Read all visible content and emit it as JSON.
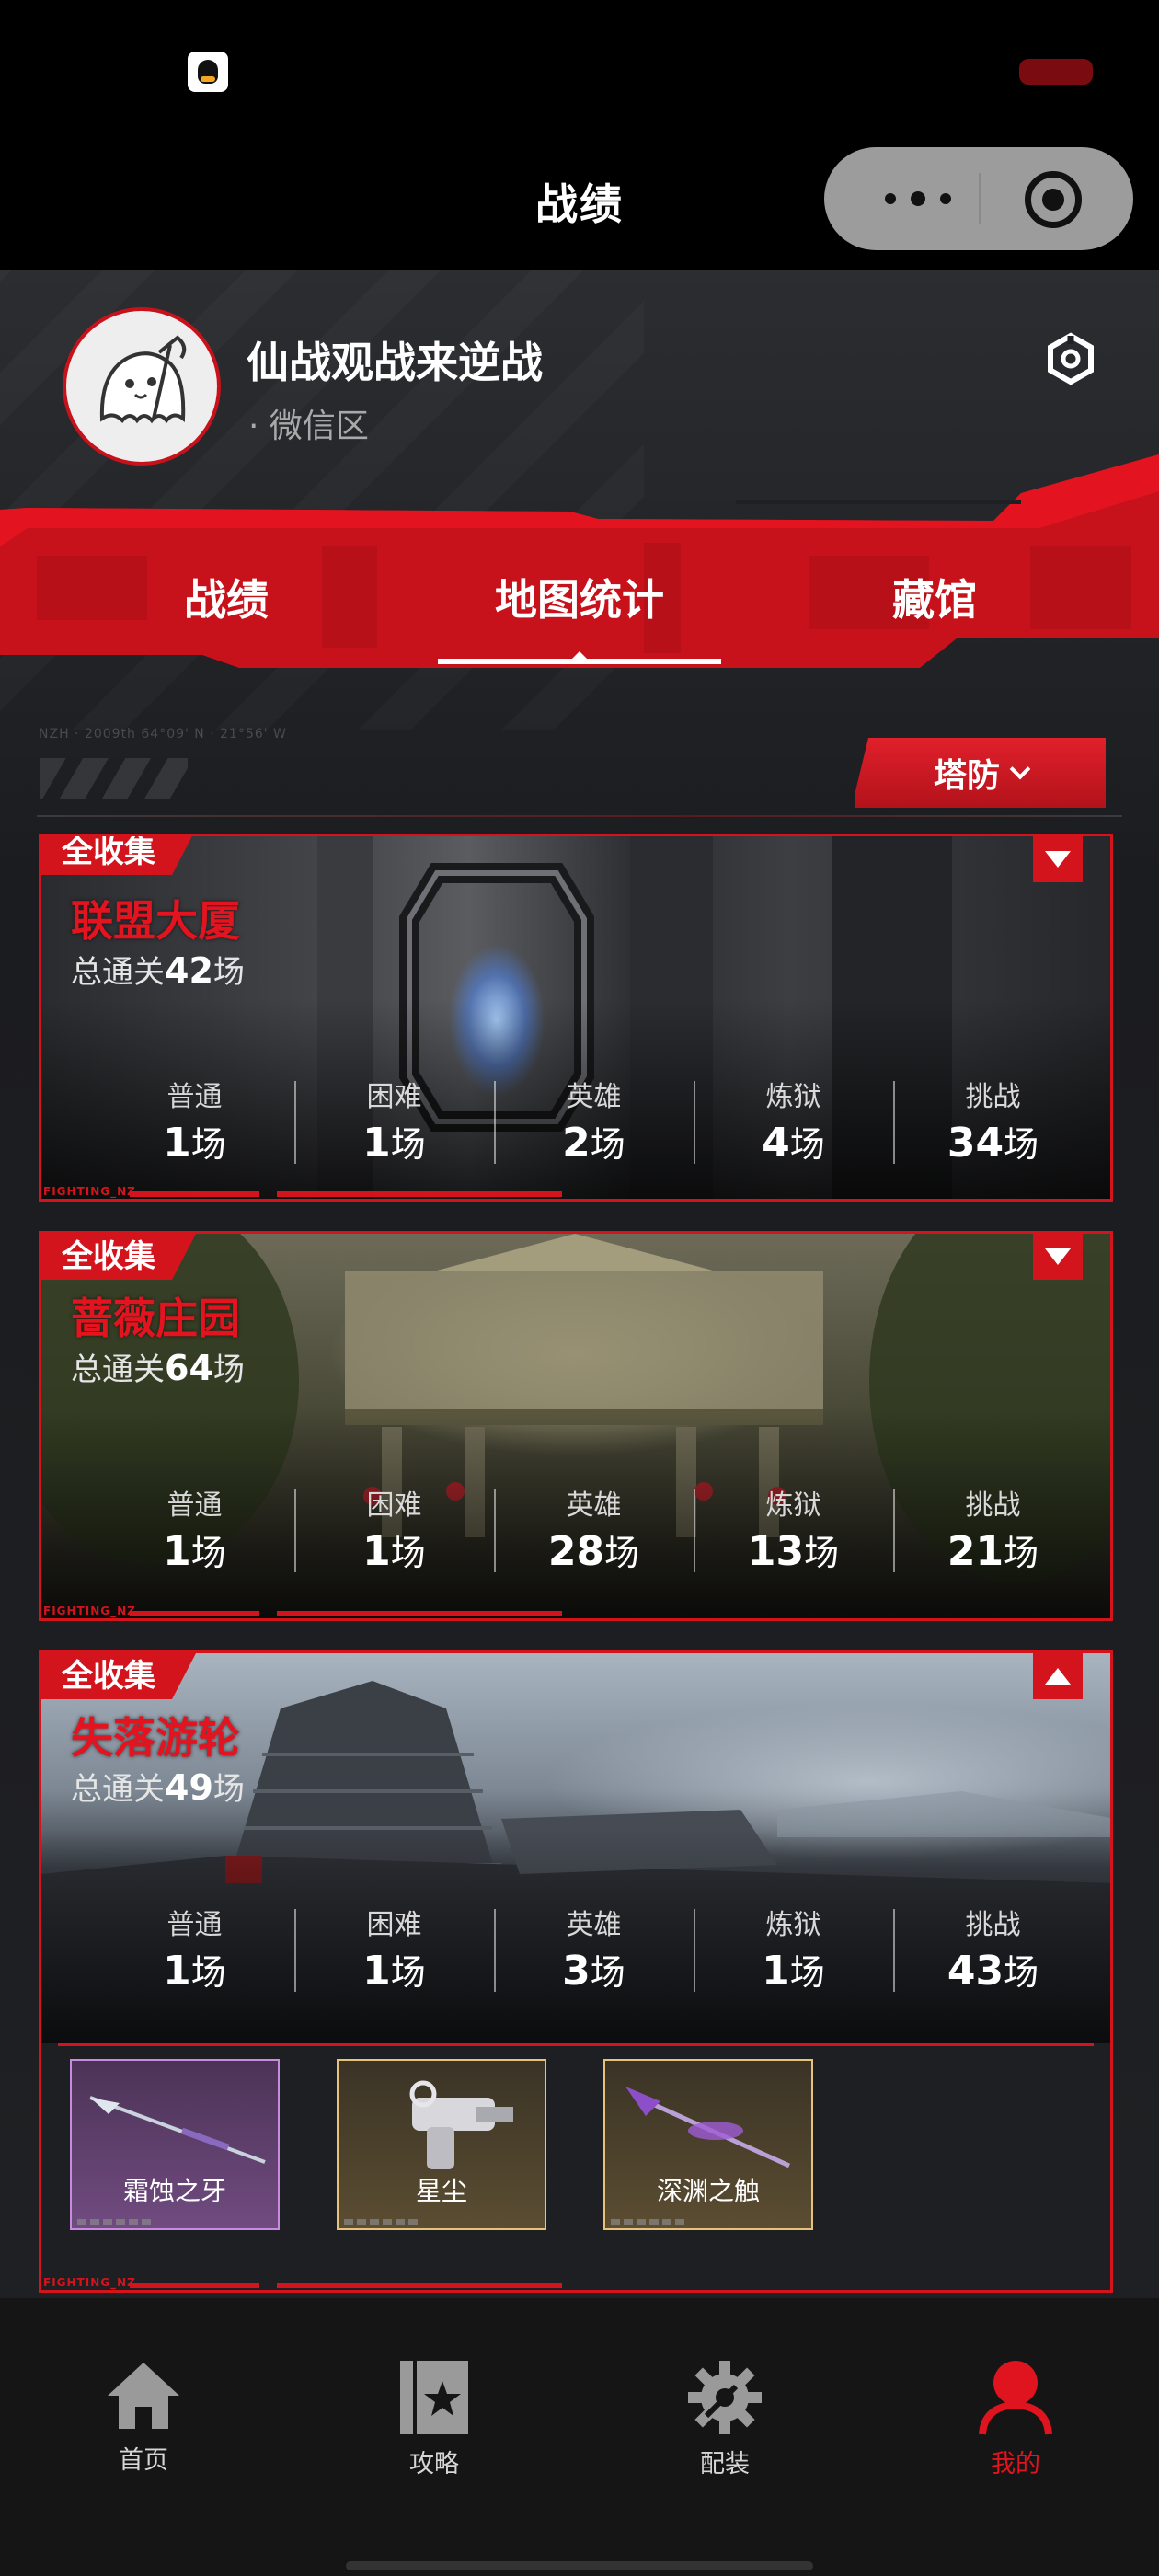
{
  "colors": {
    "accent": "#d4141d",
    "accent_bright": "#e3141f",
    "background": "#1e1f22",
    "bar": "#000000"
  },
  "statusbar": {
    "app_icon": "qq-icon",
    "battery": "battery-icon"
  },
  "navbar": {
    "title": "战绩",
    "more_icon": "more-icon",
    "close_icon": "target-icon"
  },
  "profile": {
    "name": "仙战观战来逆战",
    "zone": "· 微信区",
    "settings_icon": "hexagon-settings-icon"
  },
  "tabs": [
    {
      "label": "战绩",
      "active": false
    },
    {
      "label": "地图统计",
      "active": true
    },
    {
      "label": "藏馆",
      "active": false
    }
  ],
  "filter": {
    "label": "塔防",
    "code": "NZH · 2009th 64°09' N · 21°56' W"
  },
  "difficulty_labels": [
    "普通",
    "困难",
    "英雄",
    "炼狱",
    "挑战"
  ],
  "unit": "场",
  "total_prefix": "总通关",
  "maps": [
    {
      "badge": "全收集",
      "name": "联盟大厦",
      "total": "42",
      "expanded": false,
      "counts": [
        "1",
        "1",
        "2",
        "4",
        "34"
      ]
    },
    {
      "badge": "全收集",
      "name": "蔷薇庄园",
      "total": "64",
      "expanded": false,
      "counts": [
        "1",
        "1",
        "28",
        "13",
        "21"
      ]
    },
    {
      "badge": "全收集",
      "name": "失落游轮",
      "total": "49",
      "expanded": true,
      "counts": [
        "1",
        "1",
        "3",
        "1",
        "43"
      ]
    }
  ],
  "card_footer_text": "FIGHTING_NZ",
  "weapons": [
    {
      "name": "霜蚀之牙",
      "rarity": "purple"
    },
    {
      "name": "星尘",
      "rarity": "gold"
    },
    {
      "name": "深渊之触",
      "rarity": "gold"
    }
  ],
  "bottom_nav": [
    {
      "label": "首页",
      "icon": "home-icon",
      "active": false
    },
    {
      "label": "攻略",
      "icon": "guide-book-icon",
      "active": false
    },
    {
      "label": "配装",
      "icon": "gear-icon",
      "active": false
    },
    {
      "label": "我的",
      "icon": "user-icon",
      "active": true
    }
  ]
}
